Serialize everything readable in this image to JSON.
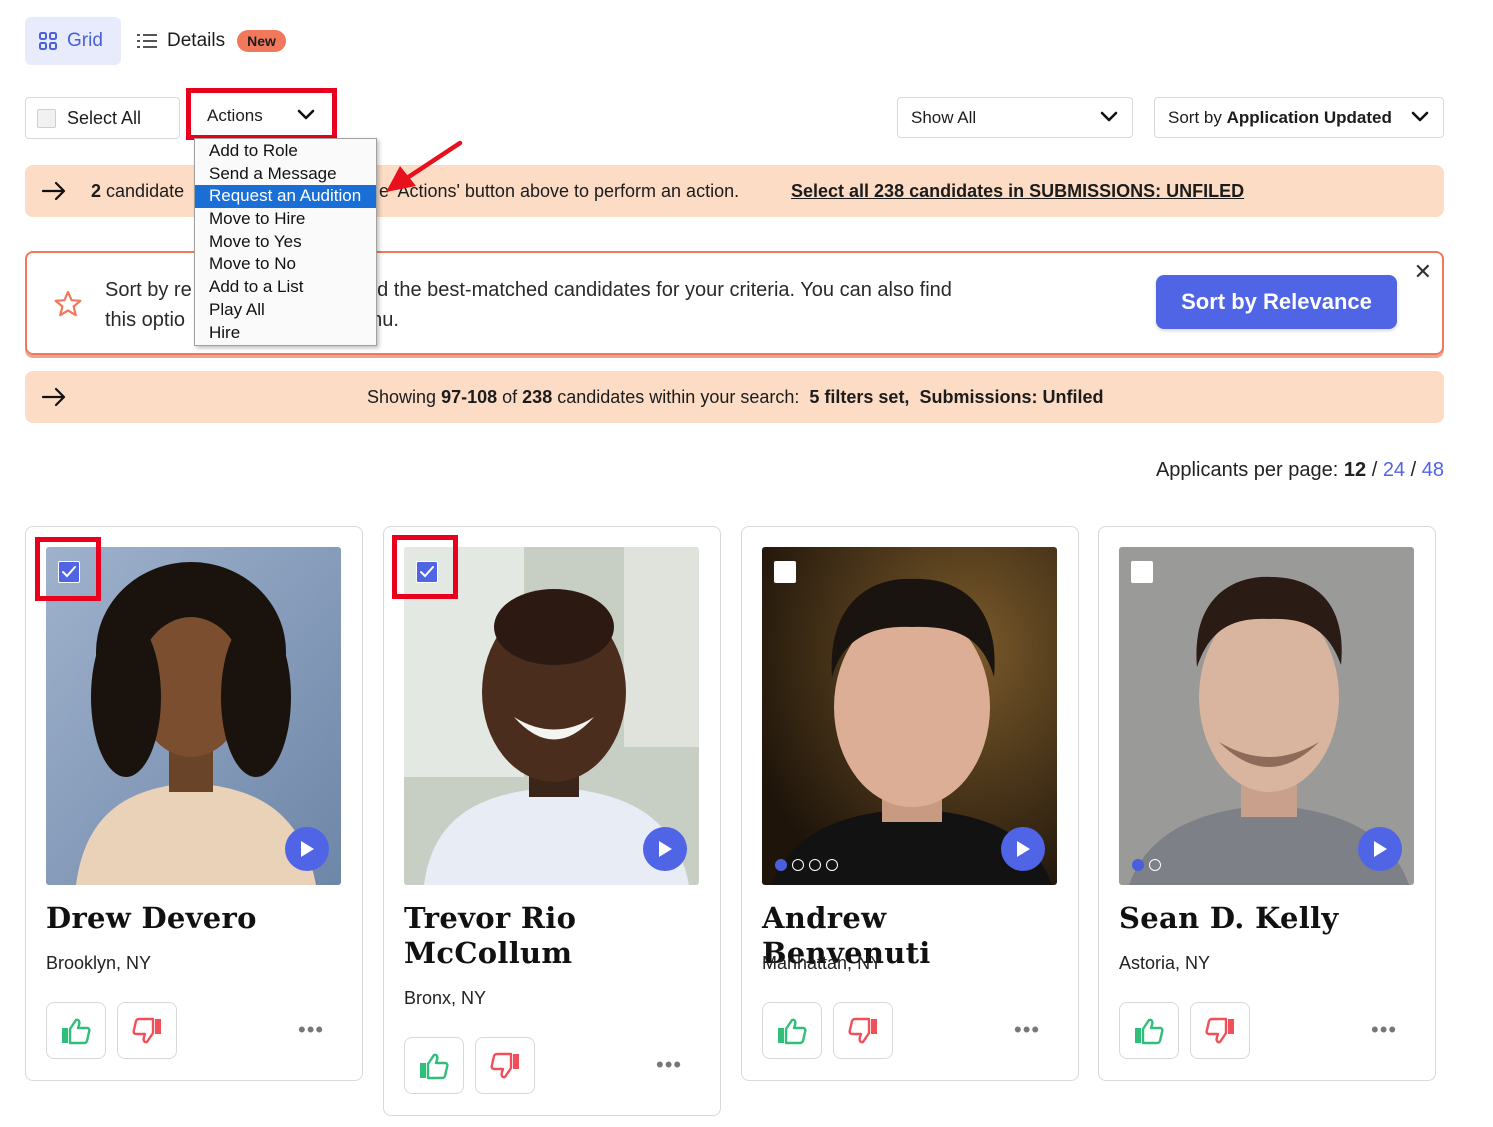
{
  "view": {
    "grid_label": "Grid",
    "details_label": "Details",
    "new_badge": "New"
  },
  "toolbar": {
    "select_all": "Select All",
    "actions": "Actions",
    "show_all": "Show All",
    "sort_prefix": "Sort by",
    "sort_value": "Application Updated"
  },
  "actions_menu": {
    "items": [
      "Add to Role",
      "Send a Message",
      "Request an Audition",
      "Move to Hire",
      "Move to Yes",
      "Move to No",
      "Add to a List",
      "Play All",
      "Hire"
    ],
    "selected": "Request an Audition"
  },
  "selection_banner": {
    "count": "2",
    "text_start": "candidate",
    "text_end": "e 'Actions' button above to perform an action.",
    "link": "Select all 238 candidates in SUBMISSIONS: UNFILED"
  },
  "relevance": {
    "line1_a": "Sort by re",
    "line1_b": "me and find the best-matched candidates for your criteria. You can also find",
    "line2_a": "this optio",
    "line2_b": "enu.",
    "button": "Sort by Relevance",
    "close": "✕"
  },
  "results_banner": {
    "showing": "Showing",
    "range": "97-108",
    "of": "of",
    "total": "238",
    "within": "candidates within your search:",
    "filters": "5 filters set,",
    "folder": "Submissions: Unfiled"
  },
  "per_page": {
    "label": "Applicants per page:",
    "current": "12",
    "sep": "/",
    "opt2": "24",
    "opt3": "48"
  },
  "candidates": [
    {
      "name": "Drew Devero",
      "location": "Brooklyn, NY",
      "checked": true
    },
    {
      "name": "Trevor Rio McCollum",
      "location": "Bronx, NY",
      "checked": true
    },
    {
      "name": "Andrew Benvenuti",
      "location": "Manhattan, NY",
      "checked": false
    },
    {
      "name": "Sean D. Kelly",
      "location": "Astoria, NY",
      "checked": false
    }
  ],
  "colors": {
    "accent": "#5064e6",
    "banner": "#fcdcc4",
    "highlight": "#e8001c",
    "thumb_up": "#2fbf7a",
    "thumb_down": "#f0505a"
  },
  "icons": [
    "grid-icon",
    "list-icon",
    "chevron-down-icon",
    "arrow-right-icon",
    "star-icon",
    "close-icon",
    "play-icon",
    "thumbs-up-icon",
    "thumbs-down-icon",
    "more-icon",
    "checkmark-icon",
    "red-pointer-arrow"
  ]
}
